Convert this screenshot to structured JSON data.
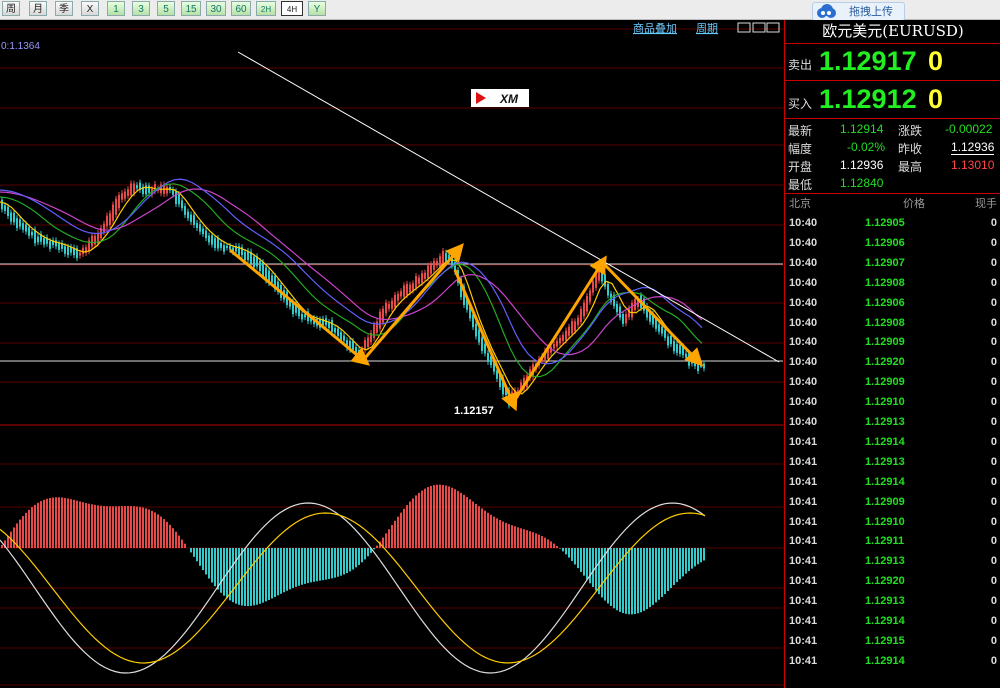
{
  "toolbar": {
    "buttons": [
      "周",
      "月",
      "季",
      "X",
      "1",
      "3",
      "5",
      "15",
      "30",
      "60",
      "2H",
      "4H",
      "Y"
    ],
    "upload_label": "拖拽上传"
  },
  "chart": {
    "top_left_label": "0:1.1364",
    "overlay_link": "商品叠加",
    "period_link": "周期",
    "logo_text": "XM",
    "low_annotation": "1.12157",
    "colors": {
      "up": "#e84a4a",
      "down": "#33cccc",
      "ma_fast": "#ffcc00",
      "ma_mid": "#22aa22",
      "ma_slow": "#cc44cc",
      "arrow": "#ffa500",
      "line": "#ffffff"
    }
  },
  "quote": {
    "title": "欧元美元(EURUSD)",
    "sell_label": "卖出",
    "sell_price": "1.12917",
    "sell_suffix": "0",
    "buy_label": "买入",
    "buy_price": "1.12912",
    "buy_suffix": "0",
    "stats": [
      {
        "label": "最新",
        "value": "1.12914",
        "label2": "涨跌",
        "value2": "-0.00022"
      },
      {
        "label": "幅度",
        "value": "-0.02%",
        "label2": "昨收",
        "value2": "1.12936"
      },
      {
        "label": "开盘",
        "value": "1.12936",
        "label2": "最高",
        "value2": "1.13010"
      },
      {
        "label": "最低",
        "value": "1.12840",
        "label2": "",
        "value2": ""
      }
    ],
    "tick_header": {
      "time": "北京",
      "price": "价格",
      "vol": "现手"
    },
    "ticks": [
      {
        "time": "10:40",
        "price": "1.12905",
        "vol": "0"
      },
      {
        "time": "10:40",
        "price": "1.12906",
        "vol": "0"
      },
      {
        "time": "10:40",
        "price": "1.12907",
        "vol": "0"
      },
      {
        "time": "10:40",
        "price": "1.12908",
        "vol": "0"
      },
      {
        "time": "10:40",
        "price": "1.12906",
        "vol": "0"
      },
      {
        "time": "10:40",
        "price": "1.12908",
        "vol": "0"
      },
      {
        "time": "10:40",
        "price": "1.12909",
        "vol": "0"
      },
      {
        "time": "10:40",
        "price": "1.12920",
        "vol": "0"
      },
      {
        "time": "10:40",
        "price": "1.12909",
        "vol": "0"
      },
      {
        "time": "10:40",
        "price": "1.12910",
        "vol": "0"
      },
      {
        "time": "10:40",
        "price": "1.12913",
        "vol": "0"
      },
      {
        "time": "10:41",
        "price": "1.12914",
        "vol": "0"
      },
      {
        "time": "10:41",
        "price": "1.12913",
        "vol": "0"
      },
      {
        "time": "10:41",
        "price": "1.12914",
        "vol": "0"
      },
      {
        "time": "10:41",
        "price": "1.12909",
        "vol": "0"
      },
      {
        "time": "10:41",
        "price": "1.12910",
        "vol": "0"
      },
      {
        "time": "10:41",
        "price": "1.12911",
        "vol": "0"
      },
      {
        "time": "10:41",
        "price": "1.12913",
        "vol": "0"
      },
      {
        "time": "10:41",
        "price": "1.12920",
        "vol": "0"
      },
      {
        "time": "10:41",
        "price": "1.12913",
        "vol": "0"
      },
      {
        "time": "10:41",
        "price": "1.12914",
        "vol": "0"
      },
      {
        "time": "10:41",
        "price": "1.12915",
        "vol": "0"
      },
      {
        "time": "10:41",
        "price": "1.12914",
        "vol": "0"
      }
    ]
  }
}
